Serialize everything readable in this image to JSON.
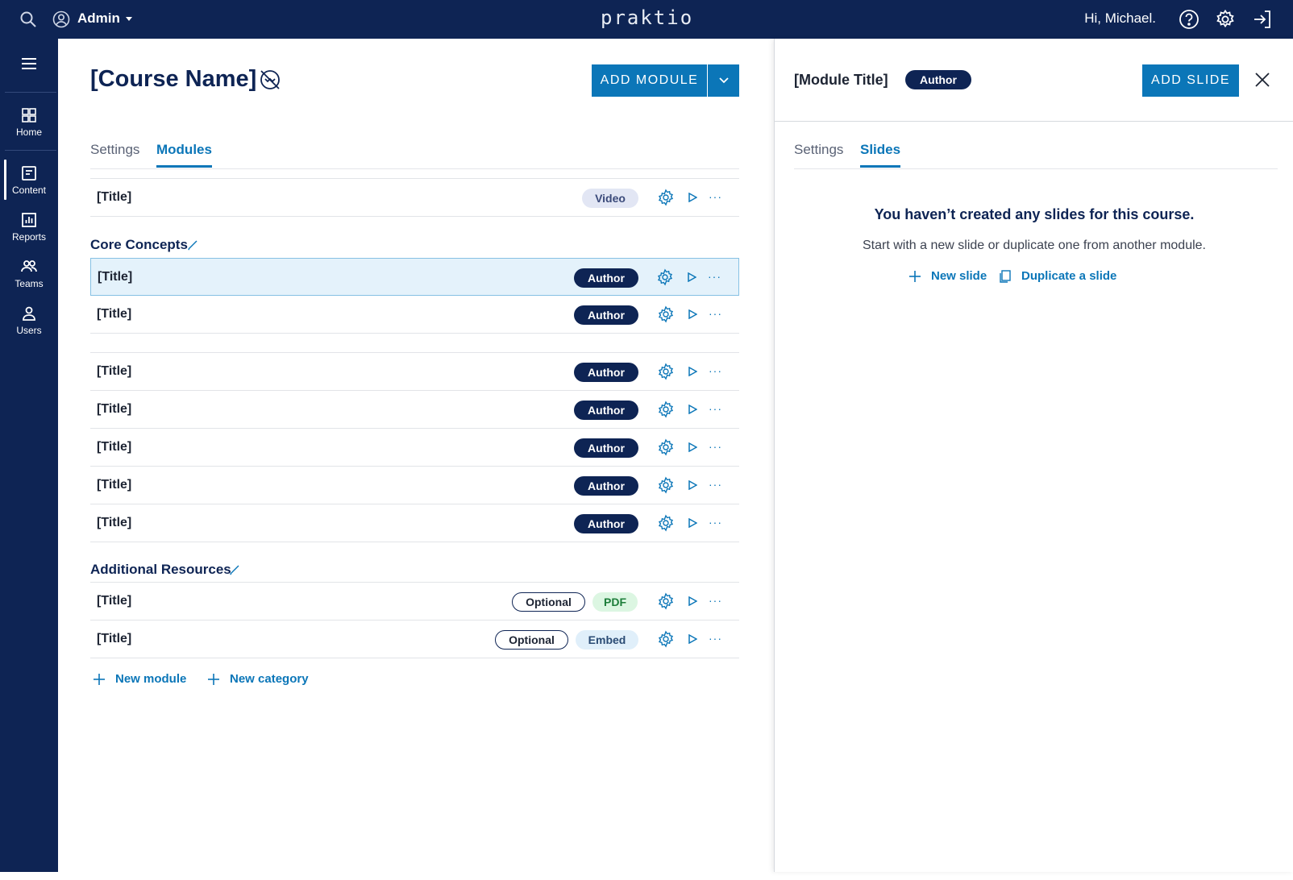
{
  "topbar": {
    "role": "Admin",
    "logo": "praktio",
    "greeting": "Hi, Michael."
  },
  "rail": {
    "items": [
      {
        "label": "Home",
        "icon": "grid-icon"
      },
      {
        "label": "Content",
        "icon": "document-icon"
      },
      {
        "label": "Reports",
        "icon": "bar-chart-icon"
      },
      {
        "label": "Teams",
        "icon": "group-icon"
      },
      {
        "label": "Users",
        "icon": "person-icon"
      }
    ],
    "active": "Content"
  },
  "course": {
    "title": "[Course Name]",
    "add_module_label": "ADD MODULE",
    "tabs": [
      "Settings",
      "Modules"
    ],
    "active_tab": "Modules",
    "uncategorized": [
      {
        "title": "[Title]",
        "badges": [
          "Video"
        ]
      }
    ],
    "categories": [
      {
        "name": "Core Concepts",
        "groups": [
          [
            {
              "title": "[Title]",
              "badges": [
                "Author"
              ],
              "selected": true
            },
            {
              "title": "[Title]",
              "badges": [
                "Author"
              ]
            }
          ],
          [
            {
              "title": "[Title]",
              "badges": [
                "Author"
              ]
            },
            {
              "title": "[Title]",
              "badges": [
                "Author"
              ]
            },
            {
              "title": "[Title]",
              "badges": [
                "Author"
              ]
            },
            {
              "title": "[Title]",
              "badges": [
                "Author"
              ]
            },
            {
              "title": "[Title]",
              "badges": [
                "Author"
              ]
            }
          ]
        ]
      },
      {
        "name": "Additional Resources",
        "groups": [
          [
            {
              "title": "[Title]",
              "badges": [
                "Optional",
                "PDF"
              ]
            },
            {
              "title": "[Title]",
              "badges": [
                "Optional",
                "Embed"
              ]
            }
          ]
        ]
      }
    ],
    "new_module_label": "New module",
    "new_category_label": "New category"
  },
  "panel": {
    "module_title": "[Module Title]",
    "badge": "Author",
    "add_slide_label": "ADD SLIDE",
    "tabs": [
      "Settings",
      "Slides"
    ],
    "active_tab": "Slides",
    "empty_title": "You haven’t created any slides for this course.",
    "empty_subtitle": "Start with a new slide or duplicate one from another module.",
    "new_slide_label": "New slide",
    "duplicate_label": "Duplicate a slide"
  },
  "colors": {
    "navy": "#0e2454",
    "accent": "#0b76b8",
    "selected_row": "#e4f2fb"
  }
}
